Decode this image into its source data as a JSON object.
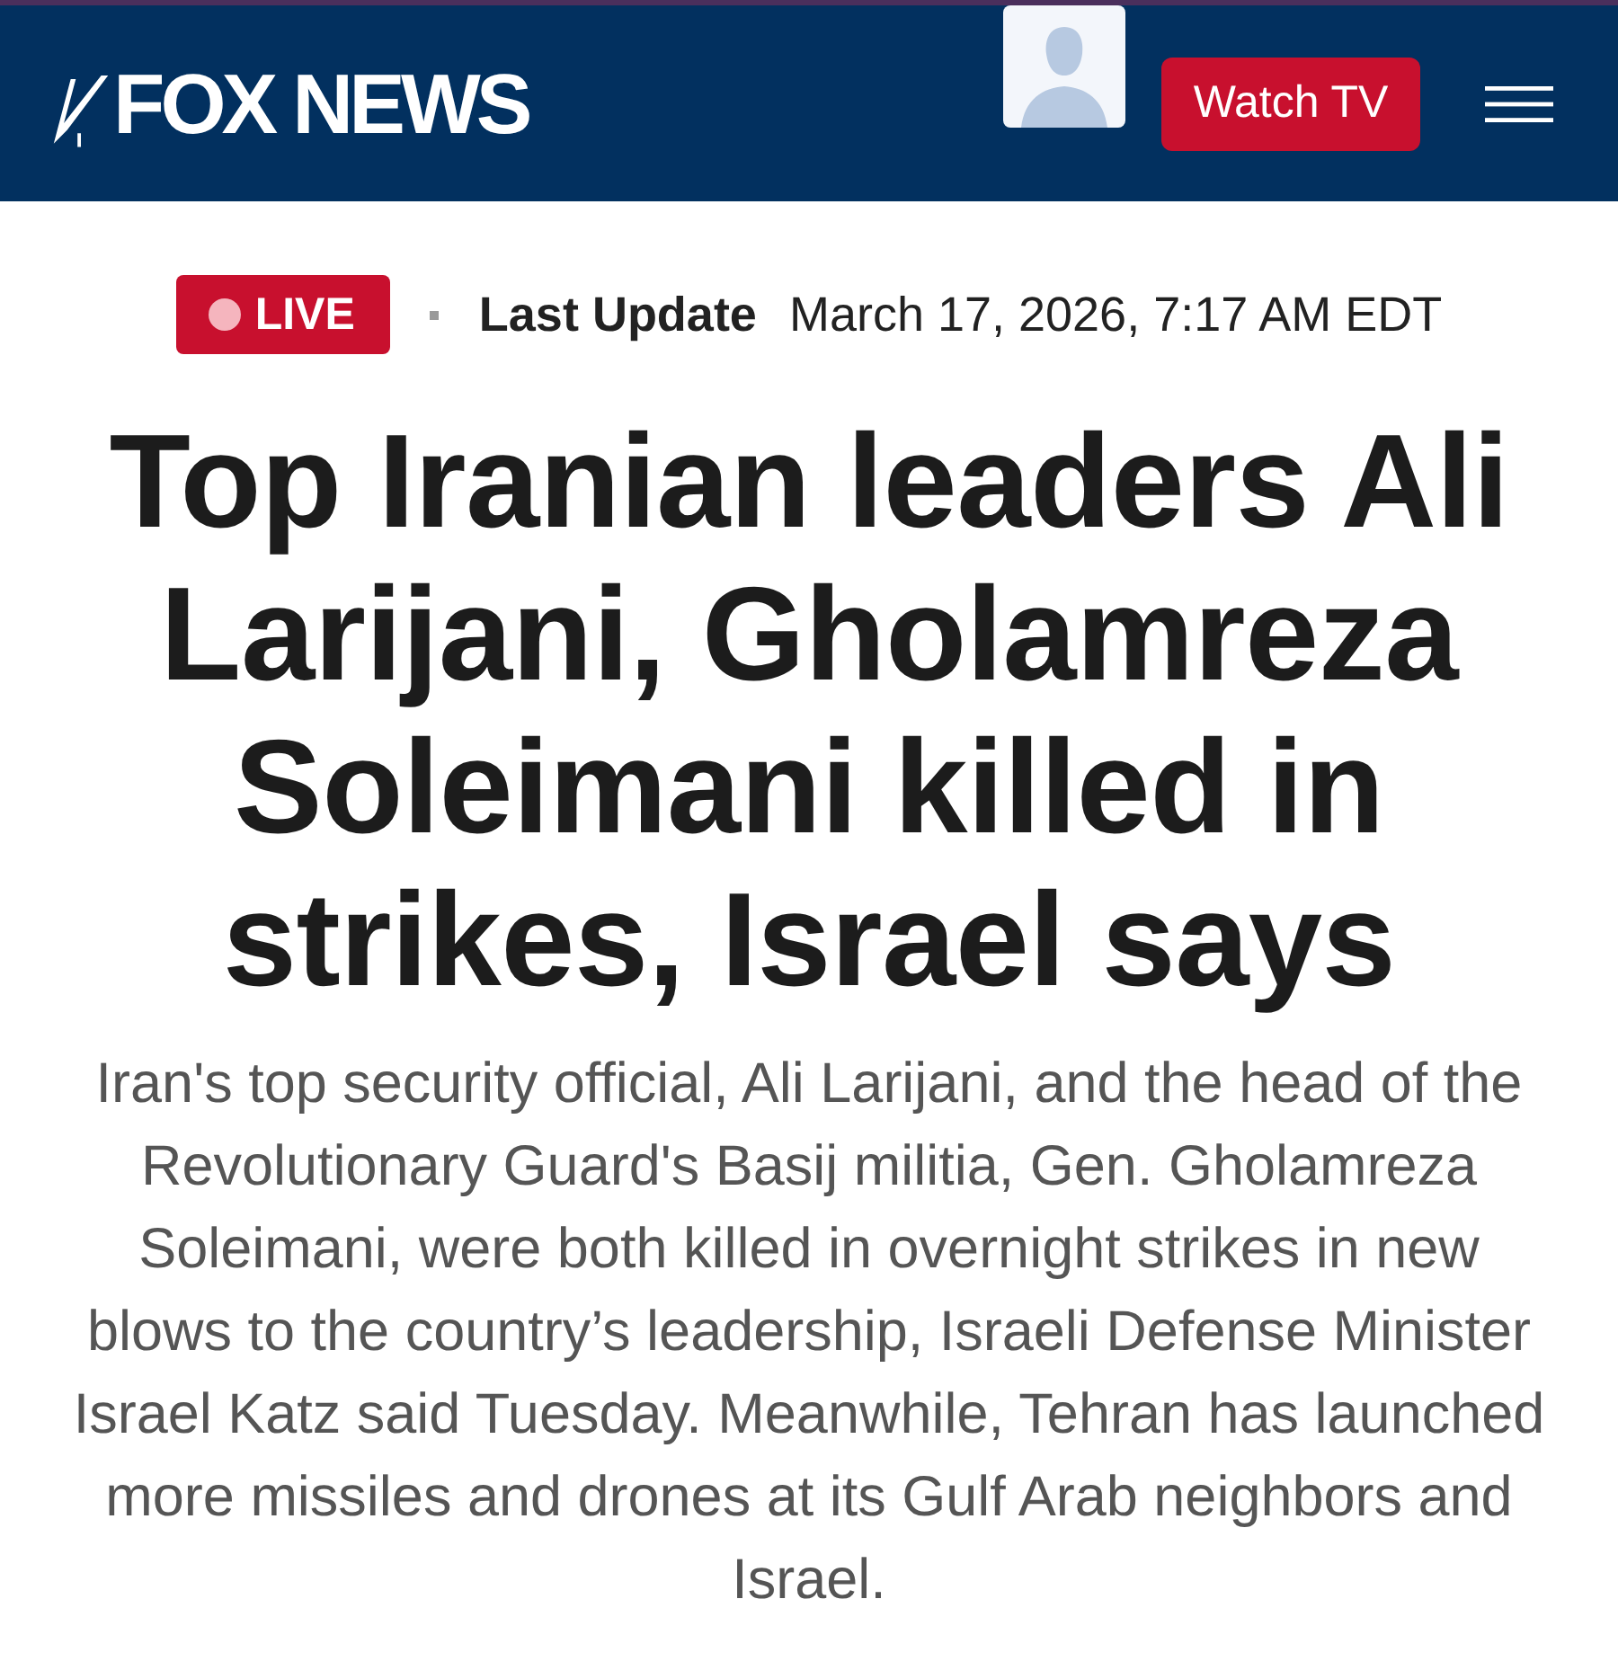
{
  "header": {
    "logo": "FOX NEWS",
    "watch_button": "Watch TV"
  },
  "update": {
    "badge": "LIVE",
    "label": "Last Update",
    "timestamp": "March 17, 2026, 7:17 AM EDT"
  },
  "headline": "Top Iranian leaders Ali Larijani, Gholamreza Soleimani killed in strikes, Israel says",
  "summary": "Iran's top security official, Ali Larijani, and the head of the Revolutionary Guard's Basij militia, Gen. Gholamreza Soleimani, were both killed in overnight strikes in new blows to the country’s leadership, Israeli Defense Minister Israel Katz said Tuesday. Meanwhile, Tehran has launched more missiles and drones at its Gulf Arab neighbors and Israel."
}
